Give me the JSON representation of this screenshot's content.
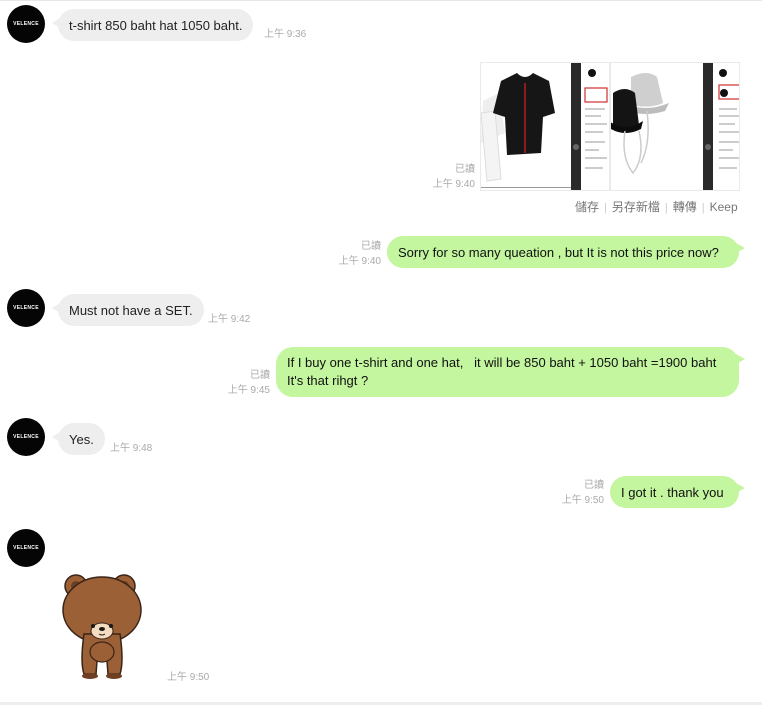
{
  "contact": {
    "avatar_text": "VELENCE"
  },
  "messages": [
    {
      "text": "t-shirt 850 baht hat 1050 baht.",
      "time": "上午 9:36"
    },
    {
      "read": "已讀",
      "time": "上午 9:40"
    },
    {
      "text": "Sorry for so many queation , but It is not this price now?",
      "read": "已讀",
      "time": "上午 9:40"
    },
    {
      "text": "Must not have a SET.",
      "time": "上午 9:42"
    },
    {
      "text_line1": "If I buy one t-shirt and one hat,   it will be 850 baht + 1050 baht =1900 baht",
      "text_line2": "It's that rihgt ?",
      "read": "已讀",
      "time": "上午 9:45"
    },
    {
      "text": "Yes.",
      "time": "上午 9:48"
    },
    {
      "text": "I got it . thank you",
      "read": "已讀",
      "time": "上午 9:50"
    },
    {
      "time": "上午 9:50"
    }
  ],
  "image_actions": {
    "save": "儲存",
    "save_to_album": "另存新檔",
    "forward": "轉傳",
    "keep": "Keep"
  },
  "icons": {
    "sticker": "brown-bear-sticker-icon",
    "photo1": "black-tshirt-photo",
    "photo2": "bucket-hat-photo"
  }
}
